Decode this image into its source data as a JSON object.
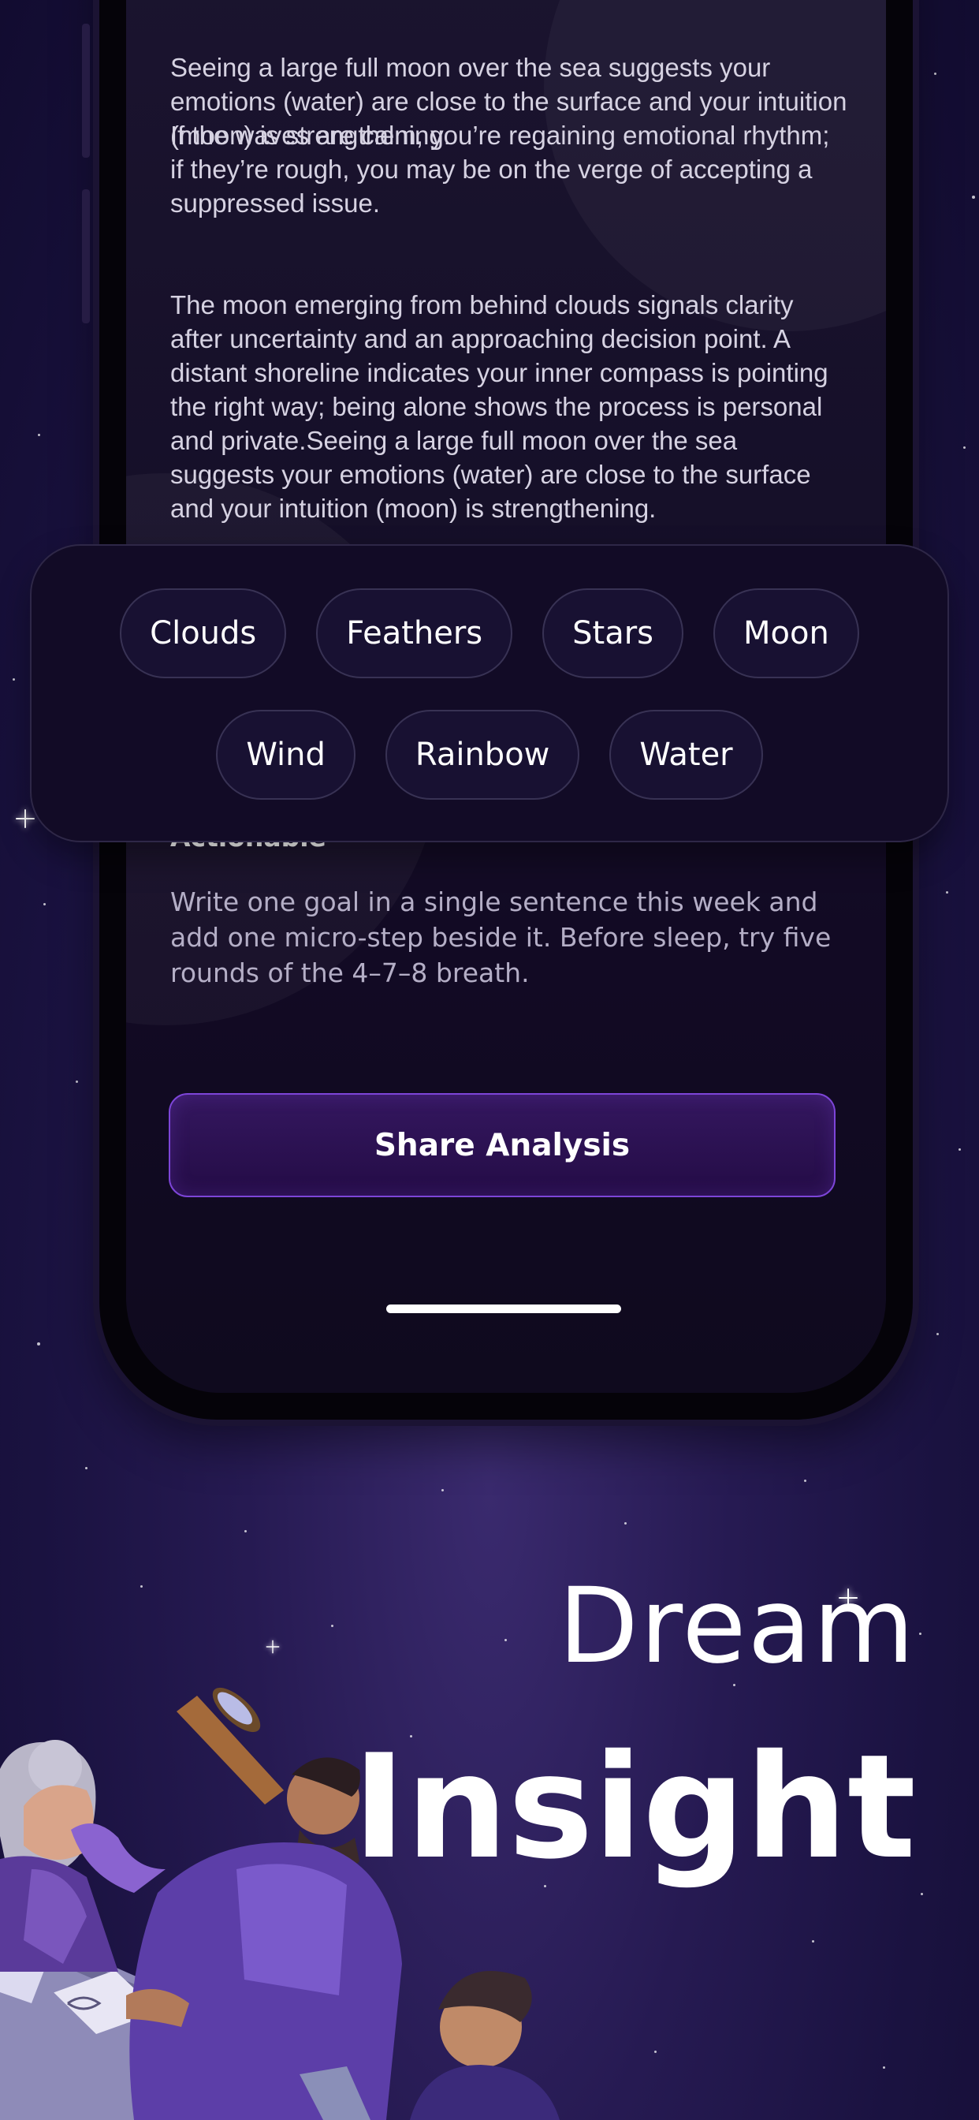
{
  "analysis": {
    "paragraph_1": "Seeing a large full moon over the sea suggests your emotions (water) are close to the surface and your intuition (moon) is strengthening.",
    "paragraph_1b": "If the waves are calm, you’re regaining emotional rhythm; if they’re rough, you may be on the verge of accepting a suppressed issue.",
    "paragraph_2": "The moon emerging from behind clouds signals clarity after uncertainty and an approaching decision point. A distant shoreline indicates your inner compass is pointing the right way; being alone shows the process is personal and private.Seeing a large full moon over the sea suggests your emotions (water) are close to the surface and your intuition (moon) is strengthening."
  },
  "symbols": {
    "row_1": [
      "Clouds",
      "Feathers",
      "Stars",
      "Moon"
    ],
    "row_2": [
      "Wind",
      "Rainbow",
      "Water"
    ]
  },
  "actionable": {
    "title": "Actionable",
    "text": "Write one goal in a single sentence this week and add one micro-step beside it. Before sleep, try five rounds of the 4–7–8 breath."
  },
  "share_button": {
    "label": "Share Analysis"
  },
  "headline": {
    "line_1": "Dream",
    "line_2": "Insight"
  },
  "colors": {
    "background": "#261a52",
    "accent": "#7d45d8",
    "button_fill": "#2a104f",
    "text_primary": "#ffffff",
    "text_secondary": "#d6d2e2"
  }
}
